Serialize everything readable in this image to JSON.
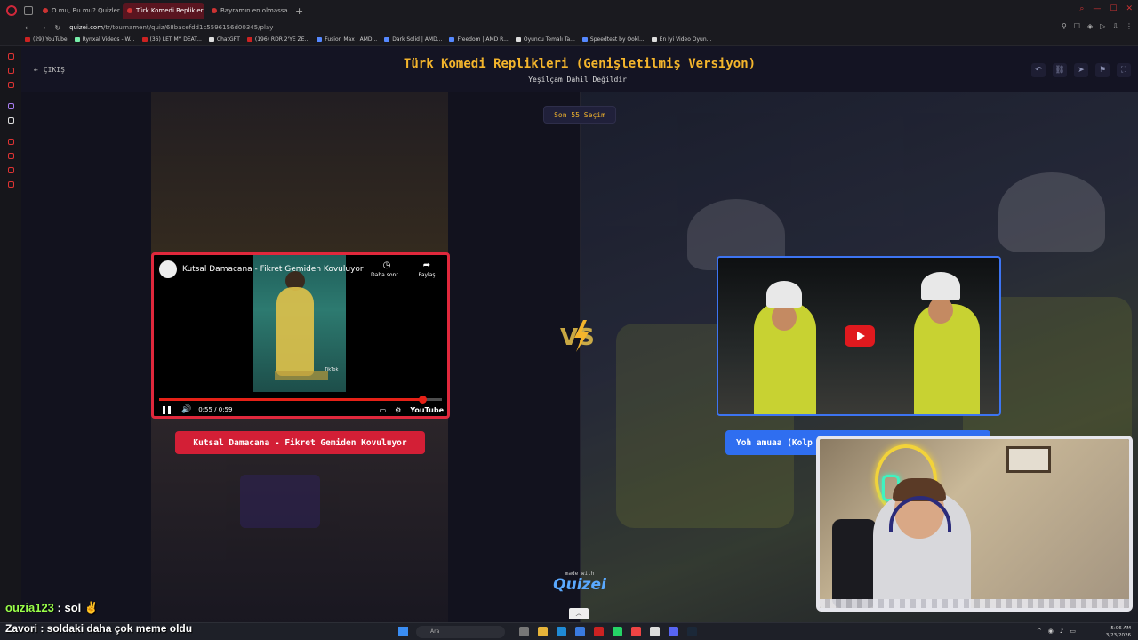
{
  "browser": {
    "tabs": [
      {
        "label": "O mu, Bu mu? Quizlerl | T...",
        "active": false
      },
      {
        "label": "Türk Komedi Replikleri",
        "active": true
      },
      {
        "label": "Bayramın en olmassa olma...",
        "active": false
      }
    ],
    "url_host": "quizei.com",
    "url_path": "/tr/tournament/quiz/68bacefdd1c5596156d00345/play",
    "bookmarks": [
      "(29) YouTube",
      "Rynxal Videos - W...",
      "(36) LET MY DEAT...",
      "ChatGPT",
      "(196) RDR 2'YE ZE...",
      "Fusion Max | AMD...",
      "Dark Solid | AMD...",
      "Freedom | AMD R...",
      "Oyuncu Temalı Ta...",
      "Speedtest by Ookl...",
      "En İyi Video Oyun..."
    ]
  },
  "header": {
    "exit_label": "ÇIKIŞ",
    "title": "Türk Komedi Replikleri (Genişletilmiş Versiyon)",
    "subtitle": "Yeşilçam Dahil Değildir!"
  },
  "round_label": "Son 55 Seçim",
  "left": {
    "video_title": "Kutsal Damacana - Fikret Gemiden Kovuluyor",
    "watch_later": "Daha sonr...",
    "share": "Paylaş",
    "time": "0:55 / 0:59",
    "progress": 0.93,
    "brand": "YouTube",
    "watermark": "TikTok",
    "button_label": "Kutsal Damacana - Fikret Gemiden Kovuluyor"
  },
  "vs_label": "VS",
  "right": {
    "button_label": "Yoh amuaa (Kolp"
  },
  "footer": {
    "made_with": "made with",
    "brand": "Quizei"
  },
  "chat": [
    {
      "user": "ouzia123",
      "message": " : sol ✌"
    },
    {
      "user": "Zavori",
      "message": " : soldaki daha çok meme oldu"
    }
  ],
  "taskbar": {
    "search_placeholder": "Ara",
    "time": "5:06 AM",
    "date": "3/23/2026"
  },
  "colors": {
    "accent_yellow": "#f4b52c",
    "left_red": "#d31f36",
    "right_blue": "#2f6ef0",
    "youtube_red": "#e62117"
  }
}
